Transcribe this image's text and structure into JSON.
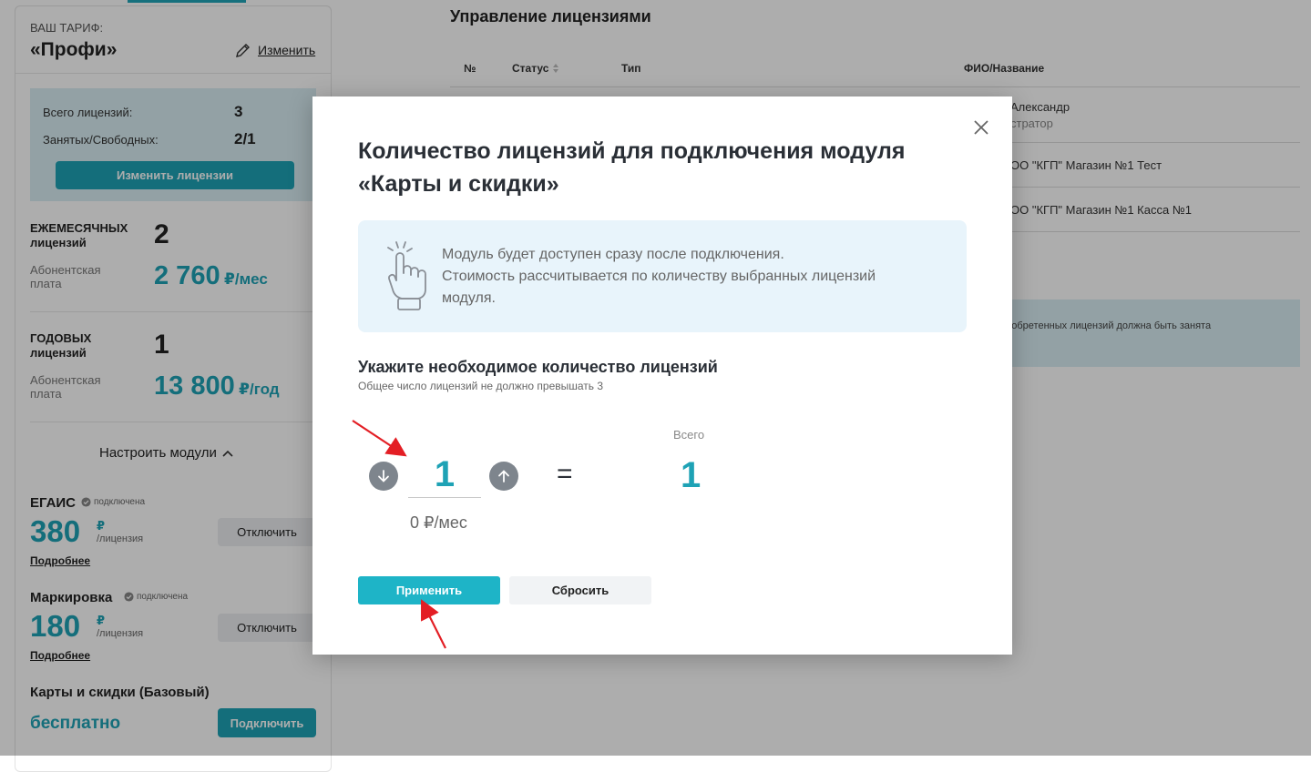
{
  "sidebar": {
    "tariff_label": "ВАШ ТАРИФ:",
    "tariff_name": "«Профи»",
    "change_link": "Изменить",
    "licenses": {
      "total_label": "Всего лицензий:",
      "total_value": "3",
      "busy_label": "Занятых/Свободных:",
      "busy_value": "2/1",
      "change_button": "Изменить лицензии"
    },
    "monthly": {
      "title_line1": "ЕЖЕМЕСЯЧНЫХ",
      "title_line2": "лицензий",
      "count": "2",
      "fee_line1": "Абонентская",
      "fee_line2": "плата",
      "price": "2 760",
      "unit": "₽/мес"
    },
    "yearly": {
      "title_line1": "ГОДОВЫХ",
      "title_line2": "лицензий",
      "count": "1",
      "fee_line1": "Абонентская",
      "fee_line2": "плата",
      "price": "13 800",
      "unit": "₽/год"
    },
    "modules_toggle": "Настроить модули",
    "modules": [
      {
        "name": "ЕГАИС",
        "status": "подключена",
        "price": "380",
        "currency": "₽",
        "per": "/лицензия",
        "more": "Подробнее",
        "button": "Отключить"
      },
      {
        "name": "Маркировка",
        "status": "подключена",
        "price": "180",
        "currency": "₽",
        "per": "/лицензия",
        "more": "Подробнее",
        "button": "Отключить"
      },
      {
        "name": "Карты и скидки (Базовый)",
        "price_text": "бесплатно",
        "button": "Подключить"
      }
    ]
  },
  "main": {
    "title": "Управление лицензиями",
    "columns": [
      "№",
      "Статус",
      "Тип",
      "ФИО/Название"
    ],
    "rows": [
      {
        "name": "Александр",
        "sub": "стратор"
      },
      {
        "name": "ОО \"КГП\" Магазин №1 Тест"
      },
      {
        "name": "ОО \"КГП\" Магазин №1 Касса №1"
      }
    ],
    "info_text": "риобретенных лицензий должна быть занята"
  },
  "modal": {
    "title_line1": "Количество лицензий для подключения модуля",
    "title_line2": "«Карты и скидки»",
    "info_line1": "Модуль будет доступен сразу после подключения.",
    "info_line2": "Стоимость рассчитывается по количеству выбранных лицензий",
    "info_line3": "модуля.",
    "section_title": "Укажите необходимое количество лицензий",
    "section_note": "Общее число лицензий не должно превышать 3",
    "quantity": "1",
    "equals": "=",
    "total_label": "Всего",
    "total_value": "1",
    "price": "0 ₽/мес",
    "apply_button": "Применить",
    "reset_button": "Сбросить"
  },
  "colors": {
    "accent": "#1ea2b5",
    "annotation_arrow": "#e31e24"
  }
}
